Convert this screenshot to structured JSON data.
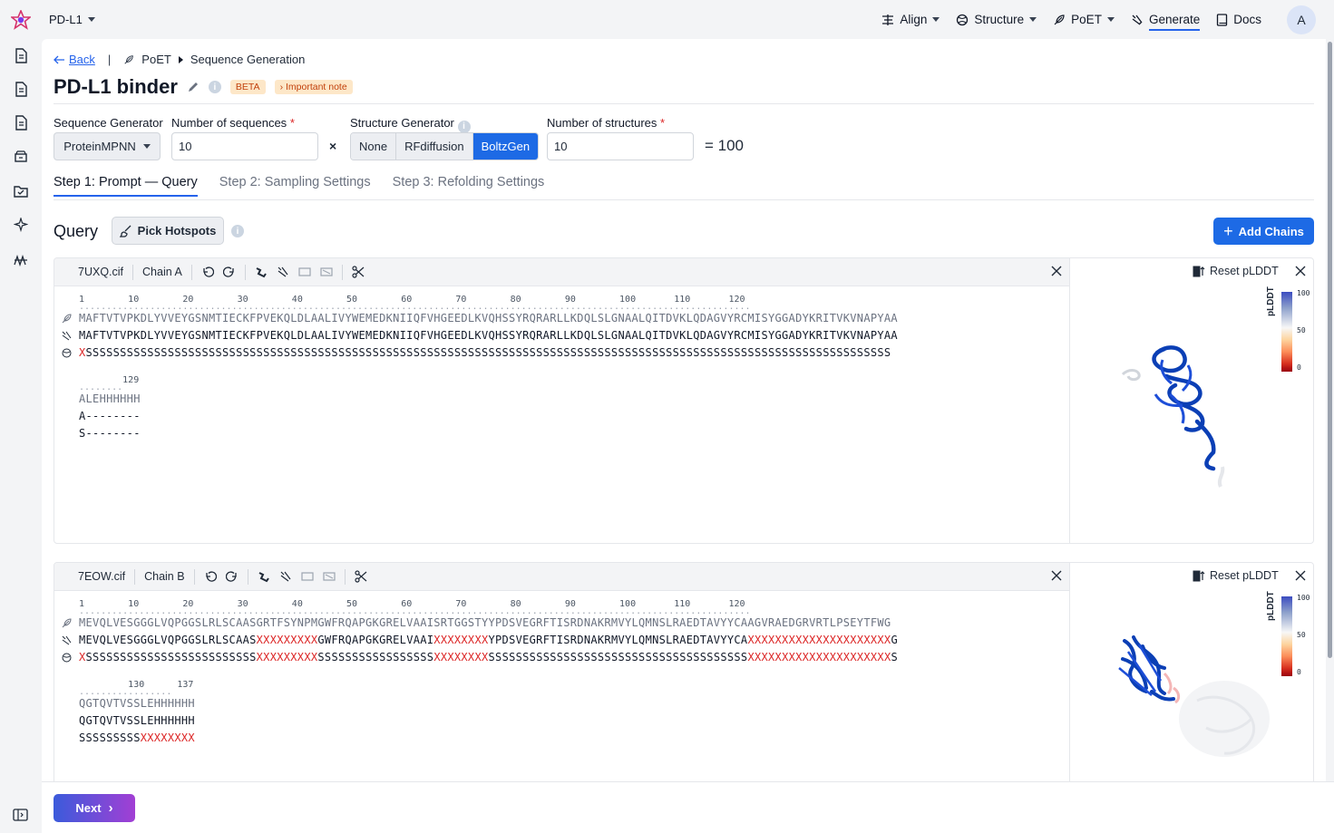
{
  "project": {
    "name": "PD-L1"
  },
  "nav": {
    "align": "Align",
    "structure": "Structure",
    "poet": "PoET",
    "generate": "Generate",
    "docs": "Docs",
    "avatar": "A"
  },
  "breadcrumb": {
    "back": "Back",
    "divider": "|",
    "parent": "PoET",
    "current": "Sequence Generation"
  },
  "page": {
    "title": "PD-L1 binder",
    "beta": "BETA",
    "note": "Important note"
  },
  "config": {
    "seq_gen_label": "Sequence Generator",
    "seq_gen_value": "ProteinMPNN",
    "num_seq_label": "Number of sequences",
    "num_seq_value": "10",
    "times": "×",
    "struct_gen_label": "Structure Generator",
    "struct_options": [
      "None",
      "RFdiffusion",
      "BoltzGen"
    ],
    "struct_selected": "BoltzGen",
    "num_struct_label": "Number of structures",
    "num_struct_value": "10",
    "total": "= 100",
    "required_mark": "*"
  },
  "tabs": [
    "Step 1: Prompt — Query",
    "Step 2: Sampling Settings",
    "Step 3: Refolding Settings"
  ],
  "query": {
    "label": "Query",
    "pick_hotspots": "Pick Hotspots",
    "add_chains": "Add Chains"
  },
  "chains": [
    {
      "file": "7UXQ.cif",
      "chain": "Chain A",
      "reset": "Reset pLDDT",
      "plddt_label": "pLDDT",
      "ruler": "1        10        20        30        40        50        60        70        80        90        100       110       120",
      "dots": "...........................................................................................................................",
      "seq1": "MAFTVTVPKDLYVVEYGSNMTIECKFPVEKQLDLAALIVYWEMEDKNIIQFVHGEEDLKVQHSSYRQRARLLKDQLSLGNAALQITDVKLQDAGVYRCMISYGGADYKRITVKVNAPYAA",
      "seq2": "MAFTVTVPKDLYVVEYGSNMTIECKFPVEKQLDLAALIVYWEMEDKNIIQFVHGEEDLKVQHSSYRQRARLLKDQLSLGNAALQITDVKLQDAGVYRCMISYGGADYKRITVKVNAPYAA",
      "seq3_parts": [
        "X",
        "SSSSSSSSSSSSSSSSSSSSSSSSSSSSSSSSSSSSSSSSSSSSSSSSSSSSSSSSSSSSSSSSSSSSSSSSSSSSSSSSSSSSSSSSSSSSSSSSSSSSSSSSSSSSSSSSSSSSSS"
      ],
      "tail_ruler": "        129",
      "tail_dots": "........",
      "tail1": "ALEHHHHHH",
      "tail2": "A--------",
      "tail3": "S--------"
    },
    {
      "file": "7EOW.cif",
      "chain": "Chain B",
      "reset": "Reset pLDDT",
      "plddt_label": "pLDDT",
      "ruler": "1        10        20        30        40        50        60        70        80        90        100       110       120",
      "dots": "...........................................................................................................................",
      "seq1": "MEVQLVESGGGLVQPGGSLRLSCAASGRTFSYNPMGWFRQAPGKGRELVAAISRTGGSTYYPDSVEGRFTISRDNAKRMVYLQMNSLRAEDTAVYYCAAGVRAEDGRVRTLPSEYTFWG",
      "seq2_parts": [
        "MEVQLVESGGGLVQPGGSLRLSCAAS",
        "XXXXXXXXX",
        "GWFRQAPGKGRELVAAI",
        "XXXXXXXX",
        "YPDSVEGRFTISRDNAKRMVYLQMNSLRAEDTAVYYCA",
        "XXXXXXXXXXXXXXXXXXXXX",
        "G"
      ],
      "seq3_parts": [
        "X",
        "SSSSSSSSSSSSSSSSSSSSSSSSS",
        "XXXXXXXXX",
        "SSSSSSSSSSSSSSSSS",
        "XXXXXXXX",
        "SSSSSSSSSSSSSSSSSSSSSSSSSSSSSSSSSSSSSS",
        "XXXXXXXXXXXXXXXXXXXXX",
        "S"
      ],
      "tail_ruler": "         130      137",
      "tail_dots": ".................",
      "tail1": "QGTQVTVSSLEHHHHHH",
      "tail2": "QGTQVTVSSLEHHHHHH",
      "tail3_parts": [
        "SSSSSSSSS",
        "XXXXXXXX"
      ]
    }
  ],
  "plddt_ticks": [
    "100",
    "50",
    "0"
  ],
  "footer": {
    "next": "Next"
  },
  "colors": {
    "accent": "#1d6ae5",
    "warning_bg": "#fde7c8",
    "warning_text": "#c2410c",
    "structure_blue": "#0b3fb5",
    "mask_red": "#dc2626"
  }
}
